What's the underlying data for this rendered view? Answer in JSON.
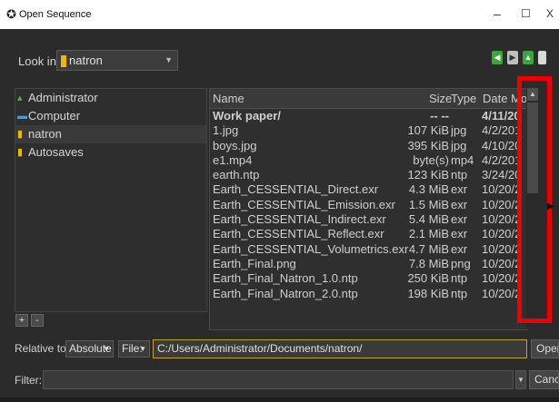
{
  "window": {
    "title": "Open Sequence",
    "icon": "open-sequence-icon",
    "minimize": "–",
    "maximize": "☐",
    "close": "X"
  },
  "toolbar": {
    "look_in_label": "Look in:",
    "look_in_value": "natron",
    "nav_icons": [
      "back-icon",
      "forward-icon",
      "up-icon",
      "new-folder-icon"
    ]
  },
  "places": [
    {
      "label": "Administrator",
      "icon": "user-icon",
      "color": "#6fa34a"
    },
    {
      "label": "Computer",
      "icon": "computer-icon",
      "color": "#4a9ad8"
    },
    {
      "label": "natron",
      "icon": "folder-icon",
      "color": "#f2b600"
    },
    {
      "label": "Autosaves",
      "icon": "folder-icon",
      "color": "#f2b600"
    }
  ],
  "places_buttons": {
    "add": "+",
    "remove": "-"
  },
  "file_list": {
    "columns": [
      "Name",
      "Size",
      "Type",
      "Date Mo"
    ],
    "rows": [
      {
        "name": "Work paper/",
        "size": "-- --",
        "type": "",
        "date": "4/11/20",
        "bold": true
      },
      {
        "name": "1.jpg",
        "size": "107 KiB",
        "type": "jpg",
        "date": "4/2/201"
      },
      {
        "name": "boys.jpg",
        "size": "395 KiB",
        "type": "jpg",
        "date": "4/10/20"
      },
      {
        "name": "e1.mp4",
        "size": "byte(s)",
        "type": "mp4",
        "date": "4/2/201"
      },
      {
        "name": "earth.ntp",
        "size": "123 KiB",
        "type": "ntp",
        "date": "3/24/20"
      },
      {
        "name": "Earth_CESSENTIAL_Direct.exr",
        "size": "4.3 MiB",
        "type": "exr",
        "date": "10/20/2"
      },
      {
        "name": "Earth_CESSENTIAL_Emission.exr",
        "size": "1.5 MiB",
        "type": "exr",
        "date": "10/20/2"
      },
      {
        "name": "Earth_CESSENTIAL_Indirect.exr",
        "size": "5.4 MiB",
        "type": "exr",
        "date": "10/20/2"
      },
      {
        "name": "Earth_CESSENTIAL_Reflect.exr",
        "size": "2.1 MiB",
        "type": "exr",
        "date": "10/20/2"
      },
      {
        "name": "Earth_CESSENTIAL_Volumetrics.exr",
        "size": "4.7 MiB",
        "type": "exr",
        "date": "10/20/2"
      },
      {
        "name": "Earth_Final.png",
        "size": "7.8 MiB",
        "type": "png",
        "date": "10/20/2"
      },
      {
        "name": "Earth_Final_Natron_1.0.ntp",
        "size": "250 KiB",
        "type": "ntp",
        "date": "10/20/2"
      },
      {
        "name": "Earth_Final_Natron_2.0.ntp",
        "size": "198 KiB",
        "type": "ntp",
        "date": "10/20/2"
      }
    ]
  },
  "bottom": {
    "relative_to_label": "Relative to:",
    "relative_to_value": "Absolute",
    "file_label": "File:",
    "path_value": "C:/Users/Administrator/Documents/natron/",
    "open_button": "Open",
    "filter_label": "Filter:",
    "filter_value": "",
    "cancel_button": "Cancel"
  },
  "colors": {
    "highlight_box": "#ee0000",
    "path_border": "#c8a11e",
    "nav_button_green": "#3aa53a"
  }
}
